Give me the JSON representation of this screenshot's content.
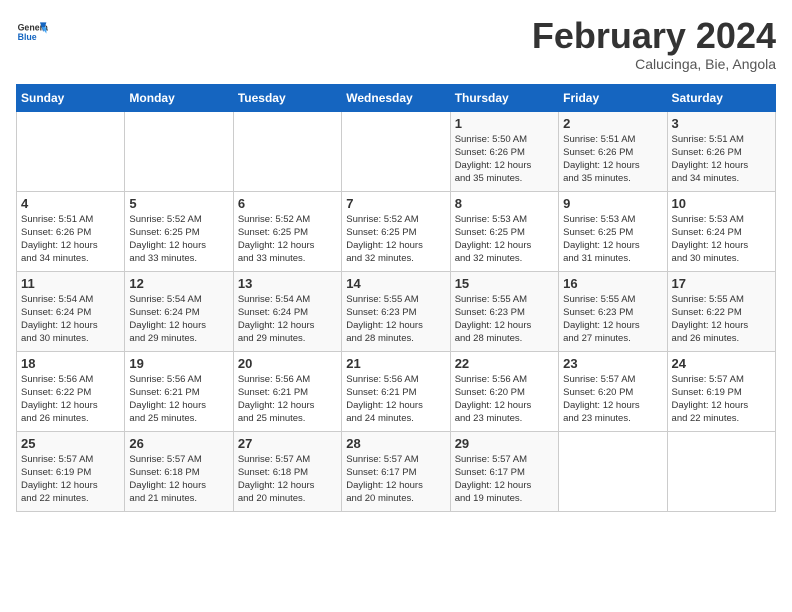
{
  "header": {
    "logo_general": "General",
    "logo_blue": "Blue",
    "month_title": "February 2024",
    "subtitle": "Calucinga, Bie, Angola"
  },
  "calendar": {
    "days_of_week": [
      "Sunday",
      "Monday",
      "Tuesday",
      "Wednesday",
      "Thursday",
      "Friday",
      "Saturday"
    ],
    "weeks": [
      [
        {
          "day": "",
          "info": ""
        },
        {
          "day": "",
          "info": ""
        },
        {
          "day": "",
          "info": ""
        },
        {
          "day": "",
          "info": ""
        },
        {
          "day": "1",
          "info": "Sunrise: 5:50 AM\nSunset: 6:26 PM\nDaylight: 12 hours\nand 35 minutes."
        },
        {
          "day": "2",
          "info": "Sunrise: 5:51 AM\nSunset: 6:26 PM\nDaylight: 12 hours\nand 35 minutes."
        },
        {
          "day": "3",
          "info": "Sunrise: 5:51 AM\nSunset: 6:26 PM\nDaylight: 12 hours\nand 34 minutes."
        }
      ],
      [
        {
          "day": "4",
          "info": "Sunrise: 5:51 AM\nSunset: 6:26 PM\nDaylight: 12 hours\nand 34 minutes."
        },
        {
          "day": "5",
          "info": "Sunrise: 5:52 AM\nSunset: 6:25 PM\nDaylight: 12 hours\nand 33 minutes."
        },
        {
          "day": "6",
          "info": "Sunrise: 5:52 AM\nSunset: 6:25 PM\nDaylight: 12 hours\nand 33 minutes."
        },
        {
          "day": "7",
          "info": "Sunrise: 5:52 AM\nSunset: 6:25 PM\nDaylight: 12 hours\nand 32 minutes."
        },
        {
          "day": "8",
          "info": "Sunrise: 5:53 AM\nSunset: 6:25 PM\nDaylight: 12 hours\nand 32 minutes."
        },
        {
          "day": "9",
          "info": "Sunrise: 5:53 AM\nSunset: 6:25 PM\nDaylight: 12 hours\nand 31 minutes."
        },
        {
          "day": "10",
          "info": "Sunrise: 5:53 AM\nSunset: 6:24 PM\nDaylight: 12 hours\nand 30 minutes."
        }
      ],
      [
        {
          "day": "11",
          "info": "Sunrise: 5:54 AM\nSunset: 6:24 PM\nDaylight: 12 hours\nand 30 minutes."
        },
        {
          "day": "12",
          "info": "Sunrise: 5:54 AM\nSunset: 6:24 PM\nDaylight: 12 hours\nand 29 minutes."
        },
        {
          "day": "13",
          "info": "Sunrise: 5:54 AM\nSunset: 6:24 PM\nDaylight: 12 hours\nand 29 minutes."
        },
        {
          "day": "14",
          "info": "Sunrise: 5:55 AM\nSunset: 6:23 PM\nDaylight: 12 hours\nand 28 minutes."
        },
        {
          "day": "15",
          "info": "Sunrise: 5:55 AM\nSunset: 6:23 PM\nDaylight: 12 hours\nand 28 minutes."
        },
        {
          "day": "16",
          "info": "Sunrise: 5:55 AM\nSunset: 6:23 PM\nDaylight: 12 hours\nand 27 minutes."
        },
        {
          "day": "17",
          "info": "Sunrise: 5:55 AM\nSunset: 6:22 PM\nDaylight: 12 hours\nand 26 minutes."
        }
      ],
      [
        {
          "day": "18",
          "info": "Sunrise: 5:56 AM\nSunset: 6:22 PM\nDaylight: 12 hours\nand 26 minutes."
        },
        {
          "day": "19",
          "info": "Sunrise: 5:56 AM\nSunset: 6:21 PM\nDaylight: 12 hours\nand 25 minutes."
        },
        {
          "day": "20",
          "info": "Sunrise: 5:56 AM\nSunset: 6:21 PM\nDaylight: 12 hours\nand 25 minutes."
        },
        {
          "day": "21",
          "info": "Sunrise: 5:56 AM\nSunset: 6:21 PM\nDaylight: 12 hours\nand 24 minutes."
        },
        {
          "day": "22",
          "info": "Sunrise: 5:56 AM\nSunset: 6:20 PM\nDaylight: 12 hours\nand 23 minutes."
        },
        {
          "day": "23",
          "info": "Sunrise: 5:57 AM\nSunset: 6:20 PM\nDaylight: 12 hours\nand 23 minutes."
        },
        {
          "day": "24",
          "info": "Sunrise: 5:57 AM\nSunset: 6:19 PM\nDaylight: 12 hours\nand 22 minutes."
        }
      ],
      [
        {
          "day": "25",
          "info": "Sunrise: 5:57 AM\nSunset: 6:19 PM\nDaylight: 12 hours\nand 22 minutes."
        },
        {
          "day": "26",
          "info": "Sunrise: 5:57 AM\nSunset: 6:18 PM\nDaylight: 12 hours\nand 21 minutes."
        },
        {
          "day": "27",
          "info": "Sunrise: 5:57 AM\nSunset: 6:18 PM\nDaylight: 12 hours\nand 20 minutes."
        },
        {
          "day": "28",
          "info": "Sunrise: 5:57 AM\nSunset: 6:17 PM\nDaylight: 12 hours\nand 20 minutes."
        },
        {
          "day": "29",
          "info": "Sunrise: 5:57 AM\nSunset: 6:17 PM\nDaylight: 12 hours\nand 19 minutes."
        },
        {
          "day": "",
          "info": ""
        },
        {
          "day": "",
          "info": ""
        }
      ]
    ]
  }
}
